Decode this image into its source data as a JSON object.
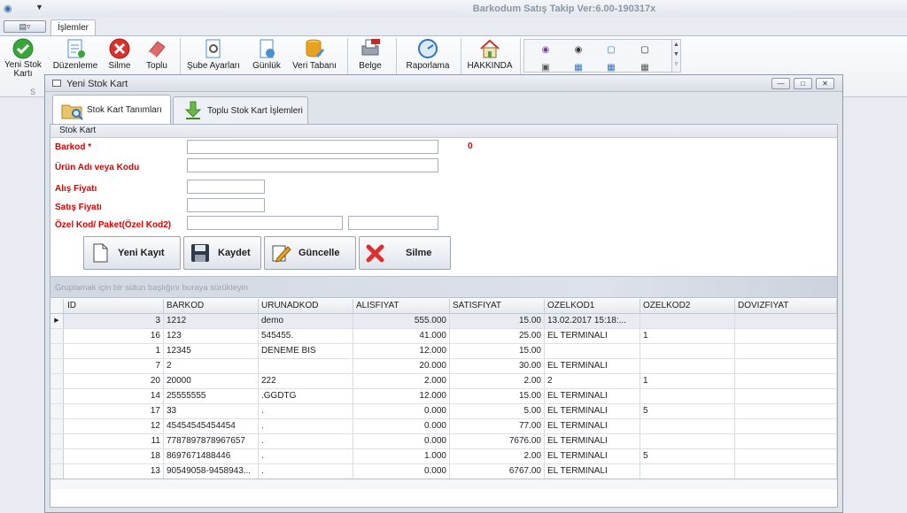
{
  "app": {
    "title": "Barkodum Satış Takip Ver:6.00-190317x",
    "menu_button_label": "▤▿",
    "tab_label": "İşlemler"
  },
  "ribbon": {
    "buttons": [
      {
        "label": "Yeni Stok\nKartı",
        "icon": "check-icon",
        "color": "#3aa53a"
      },
      {
        "label": "Düzenleme",
        "icon": "edit-doc-icon",
        "color": "#4a8fd0"
      },
      {
        "label": "Silme",
        "icon": "delete-icon",
        "color": "#d9322e"
      },
      {
        "label": "Toplu",
        "icon": "eraser-icon",
        "color": "#e06a6a"
      },
      {
        "label": "Şube Ayarları",
        "icon": "settings-doc-icon",
        "color": "#4a8fd0"
      },
      {
        "label": "Günlük",
        "icon": "daily-doc-icon",
        "color": "#4a8fd0"
      },
      {
        "label": "Veri Tabanı",
        "icon": "database-icon",
        "color": "#e8a21d"
      },
      {
        "label": "Belge",
        "icon": "pdf-printer-icon",
        "color": "#c62828"
      },
      {
        "label": "Raporlama",
        "icon": "report-gauge-icon",
        "color": "#2f74c0"
      },
      {
        "label": "HAKKINDA",
        "icon": "home-icon",
        "color": "#5aa03c"
      }
    ],
    "group_caption": "S"
  },
  "window": {
    "title": "Yeni Stok Kart",
    "tabs": [
      {
        "label": "Stok Kart Tanımları",
        "icon": "folder-search-icon"
      },
      {
        "label": "Toplu Stok Kart İşlemleri",
        "icon": "download-arrow-icon"
      }
    ],
    "group_label": "Stok Kart"
  },
  "form": {
    "barkod_label": "Barkod *",
    "urun_label": "Ürün Adı veya Kodu",
    "alis_label": "Alış Fiyatı",
    "satis_label": "Satış Fiyatı",
    "ozel_label": "Özel Kod/ Paket(Özel Kod2)",
    "counter": "0",
    "barkod_value": "",
    "urun_value": "",
    "alis_value": "",
    "satis_value": "",
    "ozel1_value": "",
    "ozel2_value": ""
  },
  "actions": {
    "yeni_kayit": "Yeni Kayıt",
    "kaydet": "Kaydet",
    "guncelle": "Güncelle",
    "silme": "Silme"
  },
  "grid": {
    "group_hint": "Gruplamak için bir sütun başlığını buraya sürükleyin",
    "columns": [
      "ID",
      "BARKOD",
      "URUNADKOD",
      "ALISFIYAT",
      "SATISFIYAT",
      "OZELKOD1",
      "OZELKOD2",
      "DOVIZFIYAT"
    ],
    "rows": [
      [
        "3",
        "1212",
        "demo",
        "555.000",
        "15.00",
        "13.02.2017 15:18:...",
        "",
        ""
      ],
      [
        "16",
        "123",
        "545455.",
        "41.000",
        "25.00",
        "EL TERMINALI",
        "1",
        ""
      ],
      [
        "1",
        "12345",
        "DENEME BIS",
        "12.000",
        "15.00",
        "",
        "",
        ""
      ],
      [
        "7",
        "2",
        "",
        "20.000",
        "30.00",
        "EL TERMINALI",
        "",
        ""
      ],
      [
        "20",
        "20000",
        "222",
        "2.000",
        "2.00",
        "2",
        "1",
        ""
      ],
      [
        "14",
        "25555555",
        ".GGDTG",
        "12.000",
        "15.00",
        "EL TERMINALI",
        "",
        ""
      ],
      [
        "17",
        "33",
        ".",
        "0.000",
        "5.00",
        "EL TERMINALI",
        "5",
        ""
      ],
      [
        "12",
        "45454545454454",
        ".",
        "0.000",
        "77.00",
        "EL TERMINALI",
        "",
        ""
      ],
      [
        "11",
        "7787897878967657",
        ".",
        "0.000",
        "7676.00",
        "EL TERMINALI",
        "",
        ""
      ],
      [
        "18",
        "8697671488446",
        ".",
        "1.000",
        "2.00",
        "EL TERMINALI",
        "5",
        ""
      ],
      [
        "13",
        "90549058-9458943...",
        ".",
        "0.000",
        "6767.00",
        "EL TERMINALI",
        "",
        ""
      ]
    ]
  }
}
